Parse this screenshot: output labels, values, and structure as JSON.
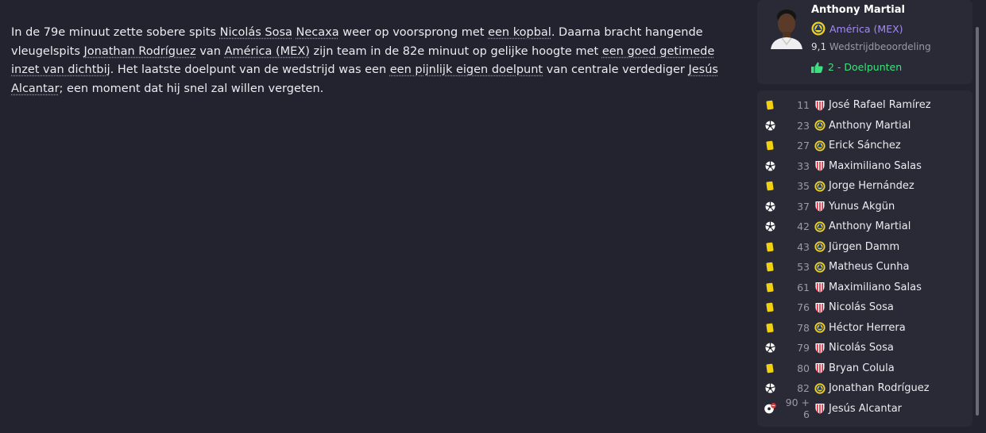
{
  "report": {
    "p": {
      "t1": "In de 79e minuut zette sobere spits ",
      "l1": "Nicolás Sosa",
      "t2": " ",
      "l2": "Necaxa",
      "t3": " weer op voorsprong met ",
      "l3": "een kopbal",
      "t4": ". Daarna bracht hangende vleugelspits ",
      "l4": "Jonathan Rodríguez",
      "t5": " van ",
      "l5": "América (MEX)",
      "t6": " zijn team in de 82e minuut op gelijke hoogte met ",
      "l6": "een goed getimede inzet van dichtbij",
      "t7": ". Het laatste doelpunt van de wedstrijd was een ",
      "l7": "een pijnlijk eigen doelpunt",
      "t8": " van centrale verdediger ",
      "l8": "Jesús Alcantar",
      "t9": "; een moment dat hij snel zal willen vergeten."
    }
  },
  "potm": {
    "name": "Anthony Martial",
    "club": "América (MEX)",
    "rating": "9,1",
    "rating_label": "Wedstrijdbeoordeling",
    "goals": "2 - Doelpunten"
  },
  "events": [
    {
      "type": "yellow",
      "minute": "11",
      "team": "necaxa",
      "player": "José Rafael Ramírez"
    },
    {
      "type": "goal",
      "minute": "23",
      "team": "america",
      "player": "Anthony Martial"
    },
    {
      "type": "yellow",
      "minute": "27",
      "team": "america",
      "player": "Erick Sánchez"
    },
    {
      "type": "goal",
      "minute": "33",
      "team": "necaxa",
      "player": "Maximiliano Salas"
    },
    {
      "type": "yellow",
      "minute": "35",
      "team": "america",
      "player": "Jorge Hernández"
    },
    {
      "type": "goal",
      "minute": "37",
      "team": "necaxa",
      "player": "Yunus Akgün"
    },
    {
      "type": "goal",
      "minute": "42",
      "team": "america",
      "player": "Anthony Martial"
    },
    {
      "type": "yellow",
      "minute": "43",
      "team": "america",
      "player": "Jürgen Damm"
    },
    {
      "type": "yellow",
      "minute": "53",
      "team": "america",
      "player": "Matheus Cunha"
    },
    {
      "type": "yellow",
      "minute": "61",
      "team": "necaxa",
      "player": "Maximiliano Salas"
    },
    {
      "type": "yellow",
      "minute": "76",
      "team": "necaxa",
      "player": "Nicolás Sosa"
    },
    {
      "type": "yellow",
      "minute": "78",
      "team": "america",
      "player": "Héctor Herrera"
    },
    {
      "type": "goal",
      "minute": "79",
      "team": "necaxa",
      "player": "Nicolás Sosa"
    },
    {
      "type": "yellow",
      "minute": "80",
      "team": "necaxa",
      "player": "Bryan Colula"
    },
    {
      "type": "goal",
      "minute": "82",
      "team": "america",
      "player": "Jonathan Rodríguez"
    },
    {
      "type": "own-goal",
      "minute": "90 + 6",
      "team": "necaxa",
      "player": "Jesús Alcantar"
    }
  ],
  "colors": {
    "background": "#23232f",
    "panel": "#2a2a37",
    "club_link": "#a48cf0",
    "goals": "#3ee07e",
    "yellow_card": "#f2d20f",
    "america_crest": "#f0d020",
    "necaxa_crest": "#d8283a"
  }
}
